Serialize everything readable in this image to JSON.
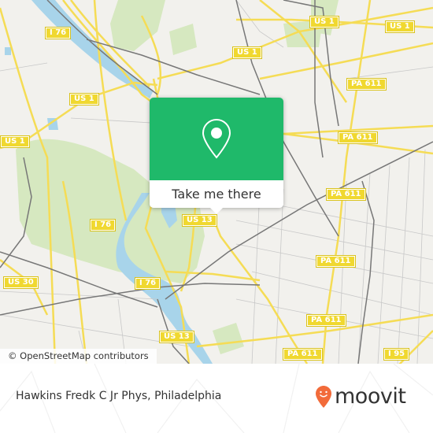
{
  "map": {
    "attribution": "© OpenStreetMap contributors",
    "colors": {
      "background": "#f2f1ed",
      "park": "#d6e8c0",
      "water": "#a8d4ea",
      "road": "#f5dc55",
      "rail": "#777777",
      "minor": "#c8c8c8"
    },
    "road_labels": [
      {
        "id": "i76-nw",
        "text": "I 76"
      },
      {
        "id": "us1-top",
        "text": "US 1"
      },
      {
        "id": "us1-top-right",
        "text": "US 1"
      },
      {
        "id": "us1-mid",
        "text": "US 1"
      },
      {
        "id": "us1-mid-left",
        "text": "US 1"
      },
      {
        "id": "us1-left",
        "text": "US 1"
      },
      {
        "id": "pa611-1",
        "text": "PA 611"
      },
      {
        "id": "pa611-2",
        "text": "PA 611"
      },
      {
        "id": "pa611-3",
        "text": "PA 611"
      },
      {
        "id": "pa611-4",
        "text": "PA 611"
      },
      {
        "id": "pa611-5",
        "text": "PA 611"
      },
      {
        "id": "pa611-6",
        "text": "PA 611"
      },
      {
        "id": "us13-1",
        "text": "US 13"
      },
      {
        "id": "us13-2",
        "text": "US 13"
      },
      {
        "id": "i76-1",
        "text": "I 76"
      },
      {
        "id": "i76-2",
        "text": "I 76"
      },
      {
        "id": "us30",
        "text": "US 30"
      },
      {
        "id": "i95",
        "text": "I 95"
      }
    ]
  },
  "popup": {
    "icon": "map-pin-icon",
    "button_label": "Take me there",
    "color": "#1fb96a"
  },
  "footer": {
    "place_name": "Hawkins Fredk C Jr Phys, Philadelphia",
    "brand": "moovit",
    "brand_color": "#f26b3a"
  }
}
